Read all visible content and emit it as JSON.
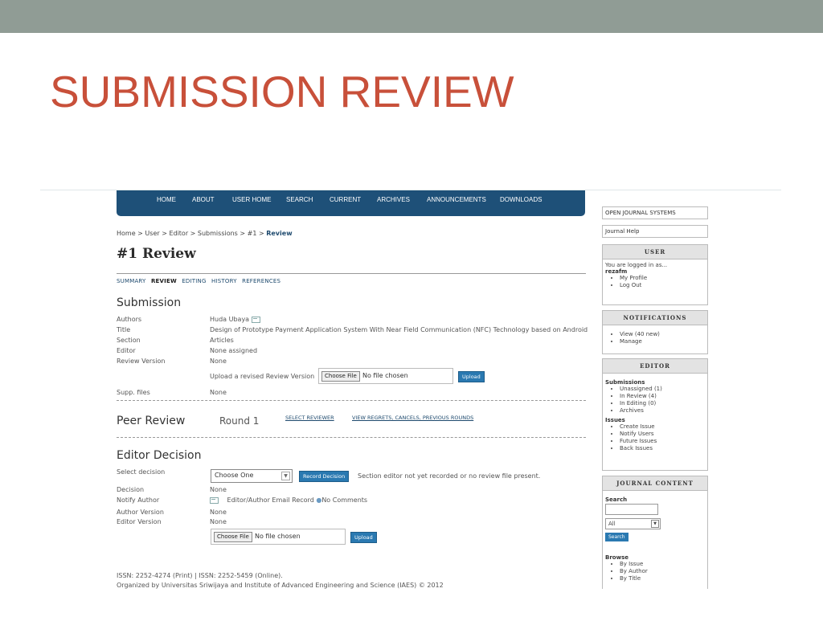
{
  "slide": {
    "title": "SUBMISSION REVIEW"
  },
  "nav": {
    "items": [
      "HOME",
      "ABOUT",
      "USER HOME",
      "SEARCH",
      "CURRENT",
      "ARCHIVES",
      "ANNOUNCEMENTS",
      "DOWNLOADS"
    ]
  },
  "breadcrumb": {
    "path": "Home > User > Editor > Submissions > #1 >",
    "current": "Review"
  },
  "page": {
    "heading": "#1 Review"
  },
  "subnav": {
    "items": [
      "SUMMARY",
      "REVIEW",
      "EDITING",
      "HISTORY",
      "REFERENCES"
    ],
    "active": "REVIEW"
  },
  "submission": {
    "title": "Submission",
    "authors_label": "Authors",
    "authors_value": "Huda Ubaya",
    "title_label": "Title",
    "title_value": "Design of Prototype Payment Application System With Near Field Communication (NFC) Technology based on Android",
    "section_label": "Section",
    "section_value": "Articles",
    "editor_label": "Editor",
    "editor_value": "None assigned",
    "review_version_label": "Review Version",
    "review_version_value": "None",
    "upload_label": "Upload a revised Review Version",
    "choose_file": "Choose File",
    "no_file": "No file chosen",
    "upload_button": "Upload",
    "supp_label": "Supp. files",
    "supp_value": "None"
  },
  "peer_review": {
    "title": "Peer Review",
    "round": "Round 1",
    "select_reviewer": "SELECT REVIEWER",
    "view_regrets": "VIEW REGRETS, CANCELS, PREVIOUS ROUNDS"
  },
  "editor_decision": {
    "title": "Editor Decision",
    "select_label": "Select decision",
    "select_value": "Choose One",
    "record_button": "Record Decision",
    "note": "Section editor not yet recorded or no review file present.",
    "decision_label": "Decision",
    "decision_value": "None",
    "notify_label": "Notify Author",
    "notify_value": "Editor/Author Email Record",
    "comments": "No Comments",
    "author_version_label": "Author Version",
    "author_version_value": "None",
    "editor_version_label": "Editor Version",
    "editor_version_value": "None",
    "choose_file": "Choose File",
    "no_file": "No file chosen",
    "upload_button": "Upload"
  },
  "footer": {
    "line1": "ISSN: 2252-4274 (Print) | ISSN: 2252-5459 (Online).",
    "line2": "Organized by Universitas Sriwijaya and Institute of Advanced Engineering and Science (IAES) © 2012"
  },
  "sidebar": {
    "ojs_link": "OPEN JOURNAL SYSTEMS",
    "help_link": "Journal Help",
    "user": {
      "head": "USER",
      "logged_in": "You are logged in as...",
      "username": "rezafm",
      "links": [
        "My Profile",
        "Log Out"
      ]
    },
    "notifications": {
      "head": "NOTIFICATIONS",
      "links": [
        "View (40 new)",
        "Manage"
      ]
    },
    "editor": {
      "head": "EDITOR",
      "submissions_label": "Submissions",
      "submissions": [
        "Unassigned (1)",
        "In Review (4)",
        "In Editing (0)",
        "Archives"
      ],
      "issues_label": "Issues",
      "issues": [
        "Create Issue",
        "Notify Users",
        "Future Issues",
        "Back Issues"
      ]
    },
    "journal_content": {
      "head": "JOURNAL CONTENT",
      "search_label": "Search",
      "search_scope": "All",
      "search_button": "Search",
      "browse_label": "Browse",
      "browse": [
        "By Issue",
        "By Author",
        "By Title"
      ]
    }
  }
}
